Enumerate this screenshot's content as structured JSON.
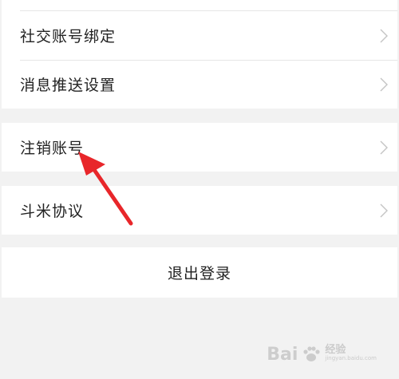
{
  "settings": {
    "group1": {
      "items": [
        {
          "label": "社交账号绑定"
        },
        {
          "label": "消息推送设置"
        }
      ]
    },
    "group2": {
      "items": [
        {
          "label": "注销账号"
        }
      ]
    },
    "group3": {
      "items": [
        {
          "label": "斗米协议"
        }
      ]
    },
    "logout_label": "退出登录"
  },
  "watermark": {
    "brand": "Bai",
    "brand_suffix": "经验",
    "sub1": "jingyan.baidu.com"
  },
  "colors": {
    "arrow": "#e8262a",
    "background": "#f2f2f2",
    "card": "#ffffff",
    "text": "#222222",
    "chevron": "#c4c4c4"
  }
}
